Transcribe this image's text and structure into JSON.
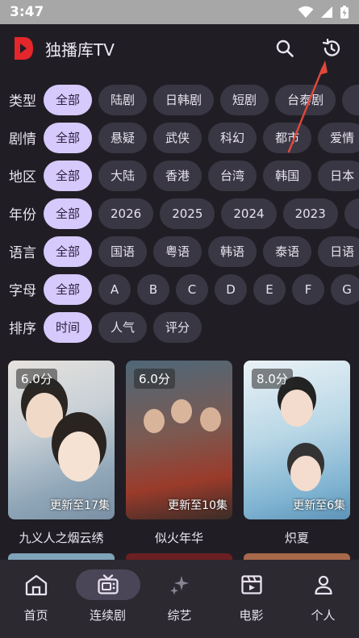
{
  "status": {
    "time": "3:47"
  },
  "app": {
    "title": "独播库TV"
  },
  "filters": [
    {
      "label": "类型",
      "options": [
        "全部",
        "陆剧",
        "日韩剧",
        "短剧",
        "台泰剧",
        "港"
      ]
    },
    {
      "label": "剧情",
      "options": [
        "全部",
        "悬疑",
        "武侠",
        "科幻",
        "都市",
        "爱情"
      ]
    },
    {
      "label": "地区",
      "options": [
        "全部",
        "大陆",
        "香港",
        "台湾",
        "韩国",
        "日本"
      ]
    },
    {
      "label": "年份",
      "options": [
        "全部",
        "2026",
        "2025",
        "2024",
        "2023",
        "2"
      ]
    },
    {
      "label": "语言",
      "options": [
        "全部",
        "国语",
        "粤语",
        "韩语",
        "泰语",
        "日语"
      ]
    },
    {
      "label": "字母",
      "options": [
        "全部",
        "A",
        "B",
        "C",
        "D",
        "E",
        "F",
        "G"
      ]
    },
    {
      "label": "排序",
      "options": [
        "时间",
        "人气",
        "评分"
      ]
    }
  ],
  "cards": [
    {
      "score": "6.0分",
      "update": "更新至17集",
      "title": "九义人之烟云绣"
    },
    {
      "score": "6.0分",
      "update": "更新至10集",
      "title": "似火年华"
    },
    {
      "score": "8.0分",
      "update": "更新至6集",
      "title": "炽夏"
    }
  ],
  "nav": [
    {
      "label": "首页",
      "icon": "home-icon"
    },
    {
      "label": "连续剧",
      "icon": "tv-icon",
      "active": true
    },
    {
      "label": "综艺",
      "icon": "sparkle-icon"
    },
    {
      "label": "电影",
      "icon": "clapperboard-icon"
    },
    {
      "label": "个人",
      "icon": "person-icon"
    }
  ],
  "colors": {
    "accent": "#d6c9fb",
    "brand": "#e5262b",
    "annotation_arrow": "#e0483c"
  }
}
